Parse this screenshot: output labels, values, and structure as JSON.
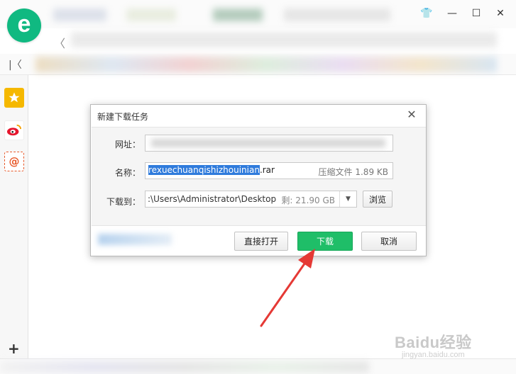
{
  "browser": {
    "logo_letter": "e",
    "window_controls": {
      "restore_icon": "shirt-icon",
      "minimize": "—",
      "maximize": "☐",
      "close": "✕"
    },
    "nav": {
      "back_icon": "chevron-left-icon",
      "collapse_icon": "collapse-left-icon"
    }
  },
  "sidebar": {
    "items": [
      {
        "name": "favorites-star-icon",
        "color": "#f5b800"
      },
      {
        "name": "weibo-icon",
        "color": "#e6162d"
      },
      {
        "name": "mail-at-icon",
        "color": "#e85a2b"
      }
    ],
    "add_label": "+"
  },
  "dialog": {
    "title": "新建下载任务",
    "close_label": "✕",
    "url_label": "网址：",
    "name_label": "名称：",
    "name_selected": "rexuechuanqishizhouinian",
    "name_ext": ".rar",
    "file_type": "压缩文件",
    "file_size": "1.89 KB",
    "save_to_label": "下载到：",
    "save_path": ":\\Users\\Administrator\\Desktop",
    "free_space_label": "剩:",
    "free_space": "21.90 GB",
    "browse_label": "浏览",
    "open_direct_label": "直接打开",
    "download_label": "下载",
    "cancel_label": "取消"
  },
  "watermark": {
    "main": "Baidu经验",
    "sub": "jingyan.baidu.com"
  },
  "colors": {
    "brand_green": "#10b981",
    "download_button": "#1fbe68",
    "selection": "#2f7bdc",
    "arrow": "#e53935"
  }
}
